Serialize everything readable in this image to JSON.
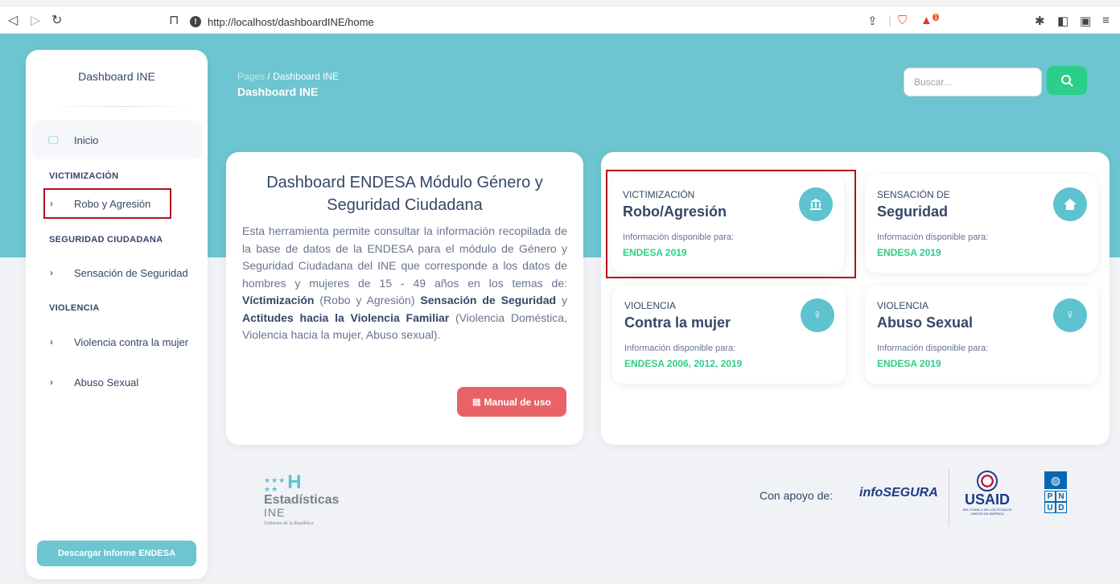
{
  "browser": {
    "url": "http://localhost/dashboardINE/home",
    "badge_count": "1"
  },
  "sidebar": {
    "brand": "Dashboard INE",
    "home_label": "Inicio",
    "sections": [
      {
        "title": "VICTIMIZACIÓN",
        "items": [
          "Robo y Agresión"
        ]
      },
      {
        "title": "SEGURIDAD CIUDADANA",
        "items": [
          "Sensación de Seguridad"
        ]
      },
      {
        "title": "VIOLENCIA",
        "items": [
          "Violencia contra la mujer",
          "Abuso Sexual"
        ]
      }
    ],
    "download_label": "Descargar Informe ENDESA"
  },
  "header": {
    "breadcrumb_root": "Pages",
    "breadcrumb_sep": "/",
    "breadcrumb_current": "Dashboard INE",
    "title": "Dashboard INE",
    "search_placeholder": "Buscar..."
  },
  "intro": {
    "title": "Dashboard ENDESA Módulo Género y Seguridad Ciudadana",
    "text_1": "Esta herramienta permite consultar la información recopilada de la base de datos de la ENDESA para el módulo de Género y Seguridad Ciudadana del INE que corresponde a los datos de hombres y mujeres de 15 - 49 años en los temas de: ",
    "bold_1": "Víctimización",
    "text_2": " (Robo y Agresión) ",
    "bold_2": "Sensación de Seguridad",
    "text_3": " y ",
    "bold_3": "Actitudes hacia la Violencia Familiar",
    "text_4": " (Violencia Doméstica, Violencia hacia la mujer, Abuso sexual).",
    "manual_label": "Manual de uso"
  },
  "modules": [
    {
      "category": "VICTIMIZACIÓN",
      "name": "Robo/Agresión",
      "available": "Información disponible para:",
      "years": "ENDESA 2019",
      "icon": "institution-icon"
    },
    {
      "category": "SENSACIÓN DE",
      "name": "Seguridad",
      "available": "Información disponible para:",
      "years": "ENDESA 2019",
      "icon": "home-icon"
    },
    {
      "category": "VIOLENCIA",
      "name": "Contra la mujer",
      "available": "Información disponible para:",
      "years": "ENDESA 2006, 2012, 2019",
      "icon": "female-icon"
    },
    {
      "category": "VIOLENCIA",
      "name": "Abuso Sexual",
      "available": "Información disponible para:",
      "years": "ENDESA 2019",
      "icon": "female-icon"
    }
  ],
  "footer": {
    "ine_logo_h": "H",
    "ine_logo_line1": "Estadísticas",
    "ine_logo_line2": "INE",
    "ine_logo_line3": "Gobierno de la República",
    "support_label": "Con apoyo de:",
    "partner_infosegura": "infoSEGURA",
    "partner_usaid": "USAID",
    "partner_usaid_tag": "DEL PUEBLO DE LOS ESTADOS UNIDOS DE AMÉRICA",
    "partner_undp": [
      "P",
      "N",
      "U",
      "D"
    ]
  },
  "colors": {
    "teal": "#6cc5d0",
    "green": "#2dce89",
    "red_button": "#e96366",
    "highlight": "#b3121a"
  }
}
